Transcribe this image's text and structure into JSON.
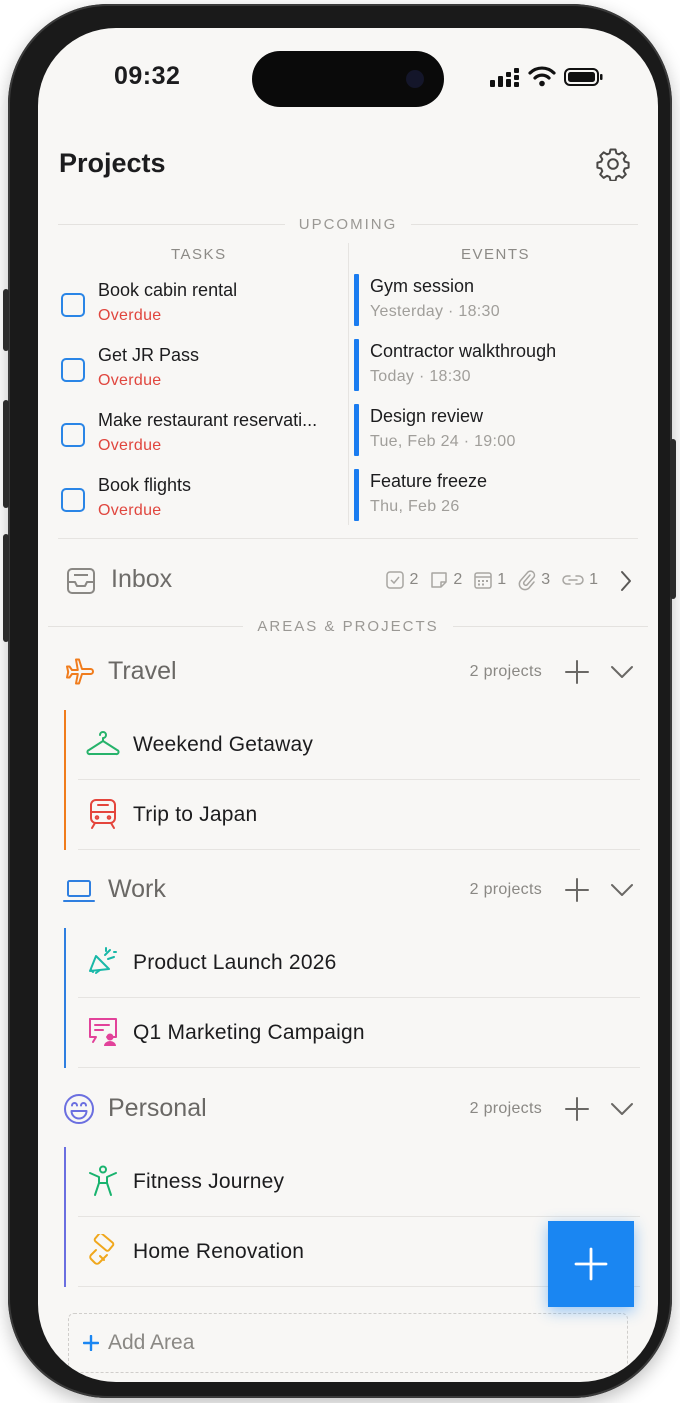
{
  "status": {
    "time": "09:32"
  },
  "header": {
    "title": "Projects"
  },
  "upcoming": {
    "label": "UPCOMING",
    "tasks_header": "TASKS",
    "events_header": "EVENTS",
    "tasks": [
      {
        "title": "Book cabin rental",
        "status": "Overdue"
      },
      {
        "title": "Get JR Pass",
        "status": "Overdue"
      },
      {
        "title": "Make restaurant reservati...",
        "status": "Overdue"
      },
      {
        "title": "Book flights",
        "status": "Overdue"
      }
    ],
    "events": [
      {
        "title": "Gym session",
        "when": "Yesterday · 18:30"
      },
      {
        "title": "Contractor walkthrough",
        "when": "Today · 18:30"
      },
      {
        "title": "Design review",
        "when": "Tue, Feb 24 · 19:00"
      },
      {
        "title": "Feature freeze",
        "when": "Thu, Feb 26"
      }
    ]
  },
  "inbox": {
    "label": "Inbox",
    "counts": {
      "tasks": "2",
      "notes": "2",
      "events": "1",
      "files": "3",
      "links": "1"
    }
  },
  "areas_label": "AREAS & PROJECTS",
  "areas": [
    {
      "name": "Travel",
      "count": "2 projects",
      "color": "#f07c1c",
      "icon": "airplane-icon",
      "projects": [
        {
          "name": "Weekend Getaway",
          "icon": "hanger-icon",
          "color": "#27b36b"
        },
        {
          "name": "Trip to Japan",
          "icon": "train-icon",
          "color": "#e4453c"
        }
      ]
    },
    {
      "name": "Work",
      "count": "2 projects",
      "color": "#2f7fe0",
      "icon": "laptop-icon",
      "projects": [
        {
          "name": "Product Launch 2026",
          "icon": "megaphone-icon",
          "color": "#19b8a8"
        },
        {
          "name": "Q1 Marketing Campaign",
          "icon": "presentation-icon",
          "color": "#e2429a"
        }
      ]
    },
    {
      "name": "Personal",
      "count": "2 projects",
      "color": "#6b6fe0",
      "icon": "smiley-icon",
      "projects": [
        {
          "name": "Fitness Journey",
          "icon": "stretching-person-icon",
          "color": "#19b36e"
        },
        {
          "name": "Home Renovation",
          "icon": "paint-roller-icon",
          "color": "#f0a71c"
        }
      ]
    }
  ],
  "add_area": {
    "label": "Add Area"
  },
  "colors": {
    "accent": "#1a86f2",
    "overdue": "#e0463e",
    "event_bar": "#1a7cf0"
  }
}
